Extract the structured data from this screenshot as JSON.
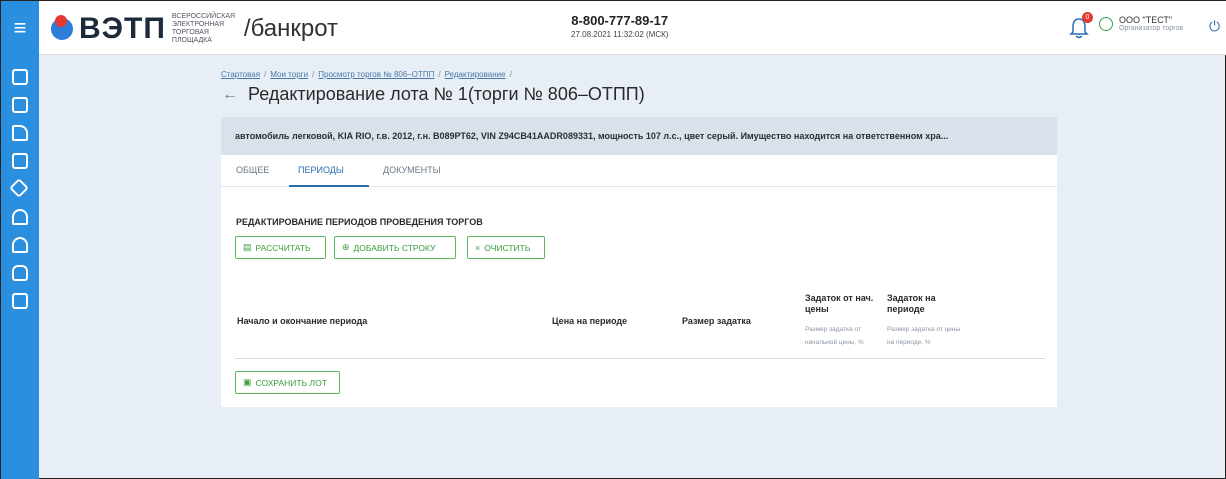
{
  "header": {
    "logo_text": "ВЭТП",
    "logo_sub": "ВСЕРОССИЙСКАЯ ЭЛЕКТРОННАЯ ТОРГОВАЯ ПЛОЩАДКА",
    "logo_section": "/банкрот",
    "phone": "8-800-777-89-17",
    "datetime": "27.08.2021 11:32:02 (МСК)",
    "notification_count": "0",
    "user_name": "ООО \"ТЕСТ\"",
    "user_role": "Организатор торгов"
  },
  "breadcrumb": {
    "items": [
      "Стартовая",
      "Мои торги",
      "Просмотр торгов № 806–ОТПП",
      "Редактирование"
    ]
  },
  "page": {
    "title": "Редактирование лота № 1(торги № 806–ОТПП)",
    "lot_description": "автомобиль легковой, KIA RIO, г.в. 2012, г.н. В089РТ62, VIN Z94CB41AADR089331, мощность 107 л.с., цвет серый. Имущество находится на ответственном хра..."
  },
  "tabs": [
    {
      "label": "ОБЩЕЕ",
      "active": false
    },
    {
      "label": "ПЕРИОДЫ",
      "active": true
    },
    {
      "label": "ДОКУМЕНТЫ",
      "active": false
    }
  ],
  "section": {
    "title": "РЕДАКТИРОВАНИЕ ПЕРИОДОВ ПРОВЕДЕНИЯ ТОРГОВ",
    "calc_button": "РАССЧИТАТЬ",
    "add_row_button": "ДОБАВИТЬ СТРОКУ",
    "clear_button": "ОЧИСТИТЬ",
    "save_button": "СОХРАНИТЬ ЛОТ"
  },
  "table": {
    "columns": [
      {
        "label": "Начало и окончание периода",
        "sub": ""
      },
      {
        "label": "Цена на периоде",
        "sub": ""
      },
      {
        "label": "Размер задатка",
        "sub": ""
      },
      {
        "label": "Задаток от нач. цены",
        "sub": "Размер задатка от начальной цены, %"
      },
      {
        "label": "Задаток на периоде",
        "sub": "Размер задатка от цены на периоде, %"
      }
    ]
  },
  "colors": {
    "sidebar": "#2b8fe0",
    "accent": "#2b6cb0",
    "button_green": "#3a9d3a",
    "badge_red": "#e53935"
  },
  "icons": {
    "menu": "menu-icon",
    "bell": "bell-icon",
    "user": "user-icon",
    "power": "power-icon",
    "back": "arrow-left-icon"
  }
}
